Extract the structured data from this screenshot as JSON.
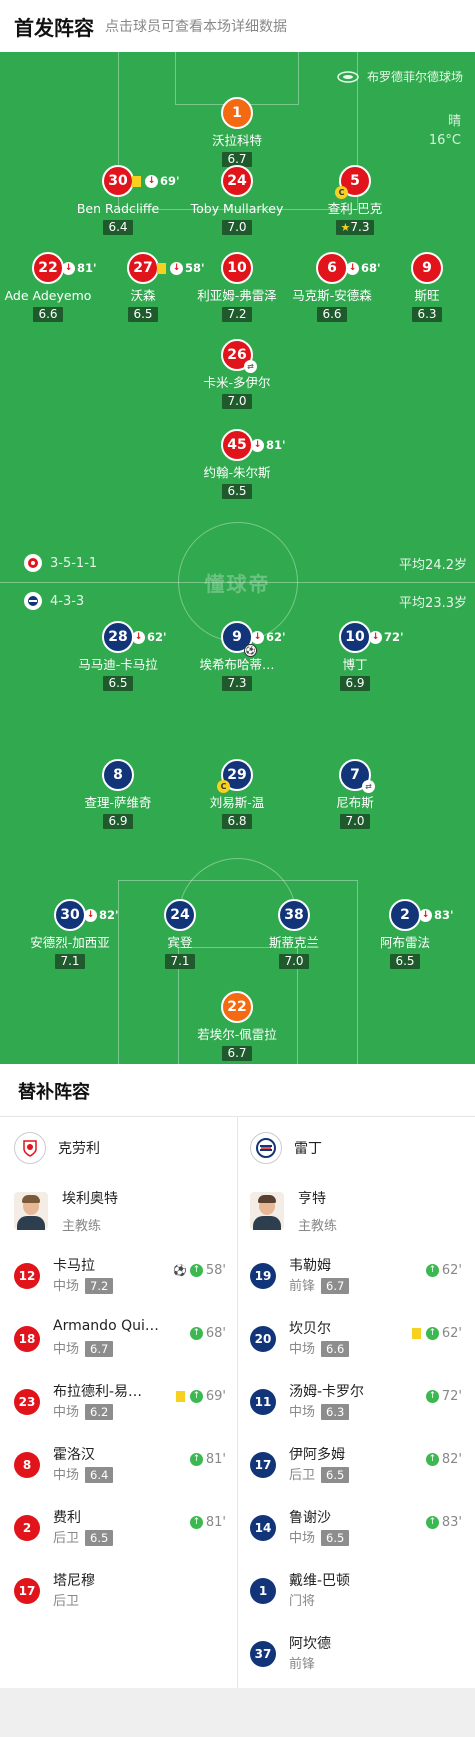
{
  "header": {
    "title": "首发阵容",
    "subtitle": "点击球员可查看本场详细数据"
  },
  "pitch": {
    "stadium": "布罗德菲尔德球场",
    "weather": "晴",
    "temperature": "16°C",
    "watermark": "懂球帝"
  },
  "home_formation": {
    "formation": "3-5-1-1",
    "avg_age": "平均24.2岁"
  },
  "away_formation": {
    "formation": "4-3-3",
    "avg_age": "平均23.3岁"
  },
  "home_players": [
    {
      "num": "1",
      "name": "沃拉科特",
      "rating": "6.7",
      "gk": true
    },
    {
      "num": "30",
      "name": "Ben Radcliffe",
      "rating": "6.4",
      "sub": "69'",
      "card": "yellow"
    },
    {
      "num": "24",
      "name": "Toby Mullarkey",
      "rating": "7.0"
    },
    {
      "num": "5",
      "name": "查利-巴克",
      "rating": "7.3",
      "captain": true,
      "star": true
    },
    {
      "num": "22",
      "name": "Ade Adeyemo",
      "rating": "6.6",
      "sub": "81'"
    },
    {
      "num": "27",
      "name": "沃森",
      "rating": "6.5",
      "sub": "58'",
      "card": "yellow"
    },
    {
      "num": "10",
      "name": "利亚姆-弗雷泽",
      "rating": "7.2"
    },
    {
      "num": "6",
      "name": "马克斯-安德森",
      "rating": "6.6",
      "sub": "68'"
    },
    {
      "num": "9",
      "name": "斯旺",
      "rating": "6.3"
    },
    {
      "num": "26",
      "name": "卡米-多伊尔",
      "rating": "7.0",
      "swap": true
    },
    {
      "num": "45",
      "name": "约翰-朱尔斯",
      "rating": "6.5",
      "sub": "81'"
    }
  ],
  "away_players": [
    {
      "num": "28",
      "name": "马马迪-卡马拉",
      "rating": "6.5",
      "sub": "62'"
    },
    {
      "num": "9",
      "name": "埃希布哈蒂…",
      "rating": "7.3",
      "sub": "62'",
      "goal": true
    },
    {
      "num": "10",
      "name": "博丁",
      "rating": "6.9",
      "sub": "72'"
    },
    {
      "num": "8",
      "name": "查理-萨维奇",
      "rating": "6.9"
    },
    {
      "num": "29",
      "name": "刘易斯-温",
      "rating": "6.8",
      "captain": true
    },
    {
      "num": "7",
      "name": "尼布斯",
      "rating": "7.0",
      "swap": true
    },
    {
      "num": "30",
      "name": "安德烈-加西亚",
      "rating": "7.1",
      "sub": "82'"
    },
    {
      "num": "24",
      "name": "宾登",
      "rating": "7.1"
    },
    {
      "num": "38",
      "name": "斯蒂克兰",
      "rating": "7.0"
    },
    {
      "num": "2",
      "name": "阿布雷法",
      "rating": "6.5",
      "sub": "83'"
    },
    {
      "num": "22",
      "name": "若埃尔-佩雷拉",
      "rating": "6.7",
      "gk": true
    }
  ],
  "substitutes": {
    "title": "替补阵容",
    "home": {
      "team": "克劳利",
      "coach": {
        "name": "埃利奥特",
        "role": "主教练"
      },
      "players": [
        {
          "num": "12",
          "name": "卡马拉",
          "pos": "中场",
          "rating": "7.2",
          "goal": true,
          "in": "58'"
        },
        {
          "num": "18",
          "name": "Armando Quit…",
          "pos": "中场",
          "rating": "6.7",
          "in": "68'"
        },
        {
          "num": "23",
          "name": "布拉德利-易…",
          "pos": "中场",
          "rating": "6.2",
          "card": "yellow",
          "in": "69'"
        },
        {
          "num": "8",
          "name": "霍洛汉",
          "pos": "中场",
          "rating": "6.4",
          "in": "81'"
        },
        {
          "num": "2",
          "name": "费利",
          "pos": "后卫",
          "rating": "6.5",
          "in": "81'"
        },
        {
          "num": "17",
          "name": "塔尼穆",
          "pos": "后卫",
          "rating": ""
        }
      ]
    },
    "away": {
      "team": "雷丁",
      "coach": {
        "name": "亨特",
        "role": "主教练"
      },
      "players": [
        {
          "num": "19",
          "name": "韦勒姆",
          "pos": "前锋",
          "rating": "6.7",
          "in": "62'"
        },
        {
          "num": "20",
          "name": "坎贝尔",
          "pos": "中场",
          "rating": "6.6",
          "card": "yellow",
          "in": "62'"
        },
        {
          "num": "11",
          "name": "汤姆-卡罗尔",
          "pos": "中场",
          "rating": "6.3",
          "in": "72'"
        },
        {
          "num": "17",
          "name": "伊阿多姆",
          "pos": "后卫",
          "rating": "6.5",
          "in": "82'"
        },
        {
          "num": "14",
          "name": "鲁谢沙",
          "pos": "中场",
          "rating": "6.5",
          "in": "83'"
        },
        {
          "num": "1",
          "name": "戴维-巴顿",
          "pos": "门将",
          "rating": ""
        },
        {
          "num": "37",
          "name": "阿坎德",
          "pos": "前锋",
          "rating": ""
        }
      ]
    }
  },
  "colors": {
    "home": "#e0141a",
    "away": "#12357a",
    "keeper": "#f46a12",
    "pitch": "#31aa4f"
  }
}
